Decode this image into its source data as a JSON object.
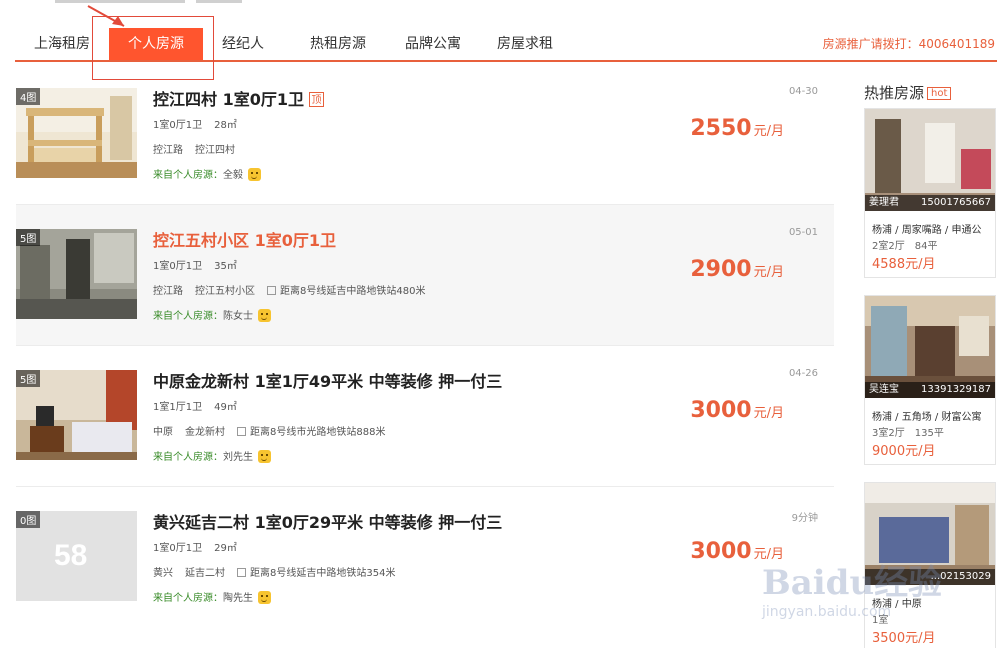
{
  "tabs": [
    {
      "label": "上海租房",
      "active": false
    },
    {
      "label": "个人房源",
      "active": true
    },
    {
      "label": "经纪人",
      "active": false
    },
    {
      "label": "热租房源",
      "active": false
    },
    {
      "label": "品牌公寓",
      "active": false
    },
    {
      "label": "房屋求租",
      "active": false
    }
  ],
  "hotline": "房源推广请拨打：4006401189",
  "listings": [
    {
      "img_count": "4图",
      "title": "控江四村 1室0厅1卫",
      "top_badge": "顶",
      "layout": "1室0厅1卫",
      "area": "28㎡",
      "district": "控江路",
      "community": "控江四村",
      "metro": "",
      "source_label": "来自个人房源：",
      "contact": "全毅",
      "date": "04-30",
      "price": "2550",
      "unit": "元/月",
      "highlighted": false
    },
    {
      "img_count": "5图",
      "title": "控江五村小区 1室0厅1卫",
      "top_badge": "",
      "layout": "1室0厅1卫",
      "area": "35㎡",
      "district": "控江路",
      "community": "控江五村小区",
      "metro": "距离8号线延吉中路地铁站480米",
      "source_label": "来自个人房源：",
      "contact": "陈女士",
      "date": "05-01",
      "price": "2900",
      "unit": "元/月",
      "highlighted": true
    },
    {
      "img_count": "5图",
      "title": "中原金龙新村 1室1厅49平米 中等装修 押一付三",
      "top_badge": "",
      "layout": "1室1厅1卫",
      "area": "49㎡",
      "district": "中原",
      "community": "金龙新村",
      "metro": "距离8号线市光路地铁站888米",
      "source_label": "来自个人房源：",
      "contact": "刘先生",
      "date": "04-26",
      "price": "3000",
      "unit": "元/月",
      "highlighted": false
    },
    {
      "img_count": "0图",
      "title": "黄兴延吉二村 1室0厅29平米 中等装修 押一付三",
      "top_badge": "",
      "layout": "1室0厅1卫",
      "area": "29㎡",
      "district": "黄兴",
      "community": "延吉二村",
      "metro": "距离8号线延吉中路地铁站354米",
      "source_label": "来自个人房源：",
      "contact": "陶先生",
      "date": "9分钟",
      "price": "3000",
      "unit": "元/月",
      "highlighted": false
    }
  ],
  "placeholder_logo": "58",
  "sidebar": {
    "title": "热推房源",
    "badge": "hot",
    "cards": [
      {
        "agent": "姜理君",
        "phone": "15001765667",
        "location": "杨浦 / 周家嘴路 / 申通公",
        "rooms": "2室2厅",
        "area": "84平",
        "price": "4588元/月"
      },
      {
        "agent": "吴连宝",
        "phone": "13391329187",
        "location": "杨浦 / 五角场 / 财富公寓",
        "rooms": "3室2厅",
        "area": "135平",
        "price": "9000元/月"
      },
      {
        "agent": "",
        "phone": "...02153029",
        "location": "杨浦 / 中原",
        "rooms": "1室",
        "area": "",
        "price": "3500元/月"
      }
    ]
  },
  "watermark": {
    "big": "Baidu经验",
    "small": "jingyan.baidu.com"
  },
  "colors": {
    "accent": "#e8603c",
    "active_tab": "#ff552e",
    "source_green": "#3a8c2a"
  }
}
